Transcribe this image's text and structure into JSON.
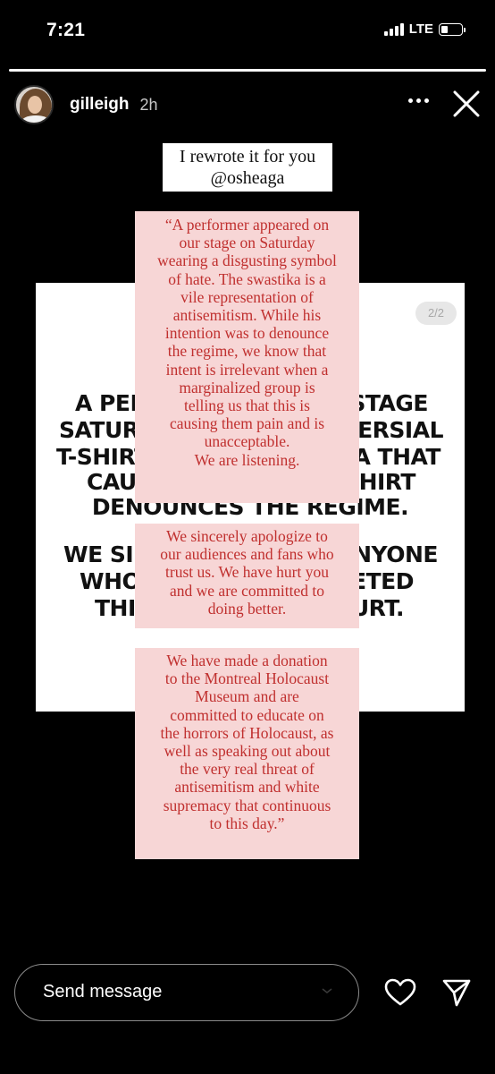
{
  "status_bar": {
    "time": "7:21",
    "network": "LTE",
    "battery_level": 0.35
  },
  "story": {
    "progress": 1.0,
    "username": "gilleigh",
    "time_ago": "2h",
    "title_lines": [
      "I rewrote it for you",
      "@osheaga"
    ],
    "card": {
      "badge": "2/2",
      "lines": [
        "A PERF",
        "STAGE",
        "SATURD",
        "VERSIAL",
        "T-SHIRT",
        "KA THAT",
        "CAUS",
        "SHIRT",
        "DENOUNCES THE REGIME.",
        "WE SIN",
        "ANYONE",
        "WHO",
        "RETED",
        "THIS",
        "HURT."
      ]
    },
    "notes": [
      [
        "“A performer appeared on",
        "our stage on Saturday",
        "wearing a disgusting symbol",
        "of hate. The swastika is a",
        "vile representation of",
        "antisemitism. While his",
        "intention was to denounce",
        "the regime, we know that",
        "intent is irrelevant when a",
        "marginalized group is",
        "telling us that this is",
        "causing them pain and is",
        "unacceptable.",
        "We are listening."
      ],
      [
        "We sincerely apologize to",
        "our audiences and fans who",
        "trust us. We have hurt you",
        "and we are committed to",
        "doing better."
      ],
      [
        "We have made a donation",
        "to the Montreal Holocaust",
        "Museum and are",
        "committed to educate on",
        "the horrors of Holocaust, as",
        "well as speaking out about",
        "the very real threat of",
        "antisemitism and white",
        "supremacy that continuous",
        "to this day.”"
      ]
    ]
  },
  "footer": {
    "message_placeholder": "Send message"
  },
  "icons": {
    "more": "more-horizontal-icon",
    "close": "close-icon",
    "heart": "heart-icon",
    "send": "send-icon",
    "chevron": "chevron-down-icon"
  },
  "colors": {
    "background": "#000000",
    "note_background": "#f7d6d6",
    "note_text": "#c0302f",
    "card_background": "#ffffff"
  }
}
